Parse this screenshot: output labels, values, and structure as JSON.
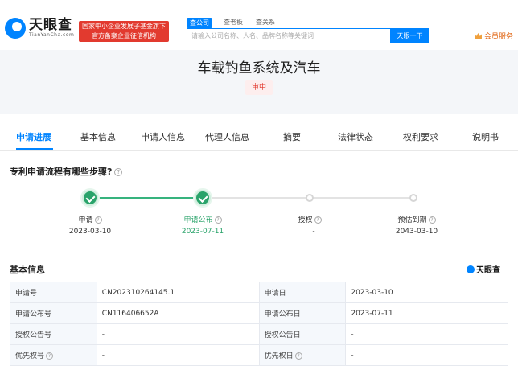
{
  "header": {
    "logo_cn": "天眼查",
    "logo_en": "TianYanCha.com",
    "badge_line1": "国家中小企业发展子基金旗下",
    "badge_line2": "官方备案企业征信机构",
    "search_tabs": [
      "查公司",
      "查老板",
      "查关系"
    ],
    "search_placeholder": "请输入公司名称、人名、品牌名称等关键词",
    "search_button": "天眼一下",
    "vip_label": "会员服务"
  },
  "patent": {
    "title": "车载钓鱼系统及汽车",
    "status": "审中"
  },
  "tabs": [
    "申请进展",
    "基本信息",
    "申请人信息",
    "代理人信息",
    "摘要",
    "法律状态",
    "权利要求",
    "说明书"
  ],
  "progress": {
    "heading": "专利申请流程有哪些步骤?",
    "steps": [
      {
        "label": "申请",
        "date": "2023-03-10"
      },
      {
        "label": "申请公布",
        "date": "2023-07-11"
      },
      {
        "label": "授权",
        "date": "-"
      },
      {
        "label": "预估到期",
        "date": "2043-03-10"
      }
    ]
  },
  "basic_info": {
    "heading": "基本信息",
    "brand": "天眼查",
    "rows": [
      {
        "label1": "申请号",
        "value1": "CN202310264145.1",
        "label2": "申请日",
        "value2": "2023-03-10"
      },
      {
        "label1": "申请公布号",
        "value1": "CN116406652A",
        "label2": "申请公布日",
        "value2": "2023-07-11"
      },
      {
        "label1": "授权公告号",
        "value1": "-",
        "label2": "授权公告日",
        "value2": "-"
      },
      {
        "label1": "优先权号",
        "value1": "-",
        "label2": "优先权日",
        "value2": "-"
      }
    ]
  },
  "colors": {
    "accent": "#0084ff",
    "success": "#29a36a",
    "badge_red": "#e23a2f",
    "vip_orange": "#e0620d"
  }
}
